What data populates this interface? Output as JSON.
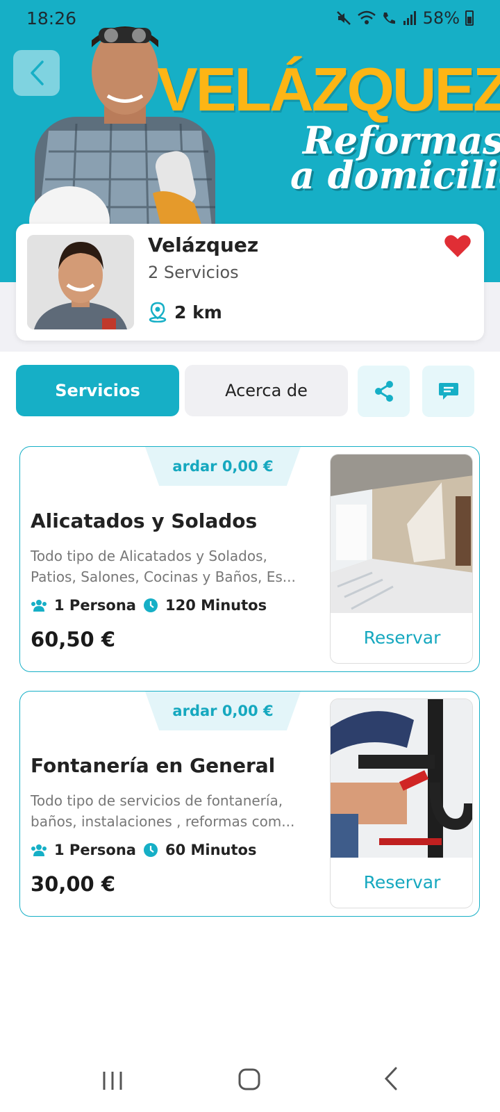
{
  "status_bar": {
    "time": "18:26",
    "battery": "58%"
  },
  "banner": {
    "brand_title": "VELÁZQUEZ",
    "tagline_1": "Reformas",
    "tagline_2": "a domicilio"
  },
  "provider": {
    "name": "Velázquez",
    "services_count": "2 Servicios",
    "distance": "2 km",
    "favorite": true
  },
  "tabs": {
    "active": "Servicios",
    "inactive": "Acerca de"
  },
  "services": [
    {
      "discount": "ardar 0,00 €",
      "title": "Alicatados y Solados",
      "desc_line1": "Todo tipo de Alicatados y Solados,",
      "desc_line2": "Patios, Salones, Cocinas y Baños, Es...",
      "persons": "1 Persona",
      "duration": "120 Minutos",
      "price": "60,50 €",
      "reserve": "Reservar"
    },
    {
      "discount": "ardar 0,00 €",
      "title": "Fontanería en General",
      "desc_line1": "Todo tipo de servicios de fontanería,",
      "desc_line2": "baños, instalaciones , reformas com...",
      "persons": "1 Persona",
      "duration": "60 Minutos",
      "price": "30,00 €",
      "reserve": "Reservar"
    }
  ],
  "colors": {
    "accent": "#16afc6",
    "brand_yellow": "#fdb515",
    "favorite_red": "#e02e35"
  }
}
